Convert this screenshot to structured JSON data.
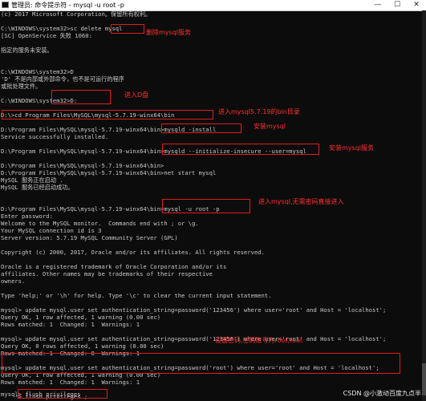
{
  "window": {
    "title": "管理员: 命令提示符 - mysql  -u root -p",
    "min_glyph": "—",
    "max_glyph": "☐",
    "close_glyph": "✕"
  },
  "console_lines": [
    "(c) 2017 Microsoft Corporation。保留所有权利。",
    "",
    "C:\\WINDOWS\\system32>sc delete mysql",
    "[SC] OpenService 失败 1060:",
    "",
    "指定的服务未安装。",
    "",
    "",
    "C:\\WINDOWS\\system32>D",
    "'D' 不是内部或外部命令，也不是可运行的程序",
    "或批处理文件。",
    "",
    "C:\\WINDOWS\\system32>D:",
    "",
    "D:\\>cd Program Files\\MySQL\\mysql-5.7.19-winx64\\bin",
    "",
    "D:\\Program Files\\MySQL\\mysql-5.7.19-winx64\\bin>mysqld -install",
    "Service successfully installed.",
    "",
    "D:\\Program Files\\MySQL\\mysql-5.7.19-winx64\\bin>mysqld --initialize-insecure --user=mysql",
    "",
    "D:\\Program Files\\MySQL\\mysql-5.7.19-winx64\\bin>",
    "D:\\Program Files\\MySQL\\mysql-5.7.19-winx64\\bin>net start mysql",
    "MySQL 服务正在启动 .",
    "MySQL 服务已经启动成功。",
    "",
    "",
    "D:\\Program Files\\MySQL\\mysql-5.7.19-winx64\\bin>mysql -u root -p",
    "Enter password:",
    "Welcome to the MySQL monitor.  Commands end with ; or \\g.",
    "Your MySQL connection id is 3",
    "Server version: 5.7.19 MySQL Community Server (GPL)",
    "",
    "Copyright (c) 2000, 2017, Oracle and/or its affiliates. All rights reserved.",
    "",
    "Oracle is a registered trademark of Oracle Corporation and/or its",
    "affiliates. Other names may be trademarks of their respective",
    "owners.",
    "",
    "Type 'help;' or '\\h' for help. Type '\\c' to clear the current input statement.",
    "",
    "mysql> update mysql.user set authentication_string=password('123456') where user='root' and Host = 'localhost';",
    "Query OK, 1 row affected, 1 warning (0.00 sec)",
    "Rows matched: 1  Changed: 1  Warnings: 1",
    "",
    "mysql> update mysql.user set authentication_string=password('123456') where user='root' and Host = 'localhost';",
    "Query OK, 0 rows affected, 1 warning (0.00 sec)",
    "Rows matched: 1  Changed: 0  Warnings: 1",
    "",
    "mysql> update mysql.user set authentication_string=password('root') where user='root' and Host = 'localhost';",
    "Query OK, 1 row affected, 1 warning (0.00 sec)",
    "Rows matched: 1  Changed: 1  Warnings: 1",
    "",
    "mysql> flush privileges",
    "    -> flush privileges ;"
  ],
  "annotations": {
    "delete_service": "删除mysql服务",
    "enter_d": "进入D盘",
    "enter_bin": "进入mysql5.7.19的bin目录",
    "install_mysql": "安装mysql",
    "install_service": "安装mysql服务",
    "login_no_password": "进入mysql,无需密码直接进入",
    "set_password": "设置密码,密码账号为root,root"
  },
  "annotation_color": "#ff3030",
  "watermark": "CSDN @小激动百度九点半"
}
